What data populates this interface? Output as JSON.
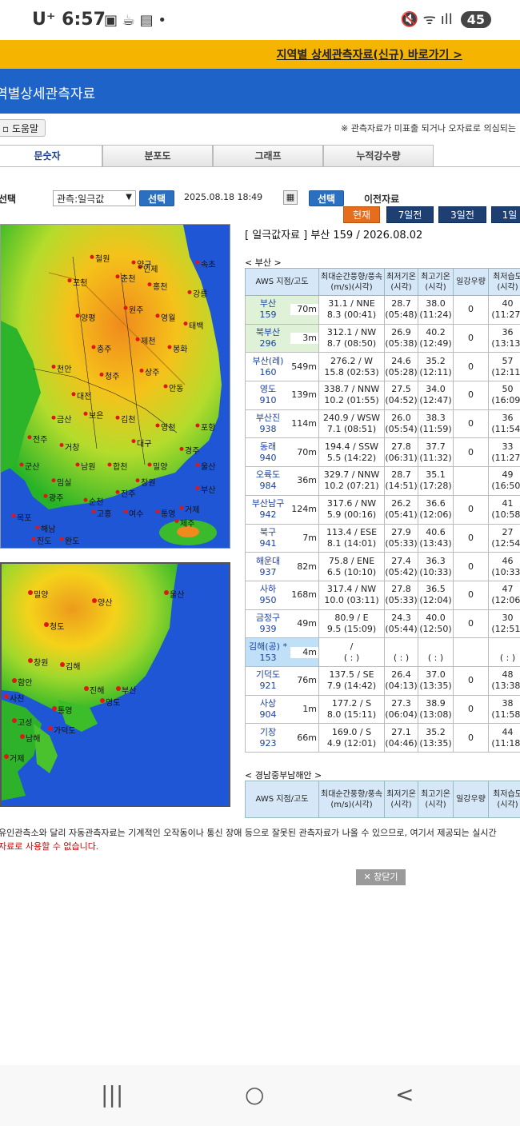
{
  "status": {
    "carrier": "U⁺",
    "time": "6:57",
    "left_icons": "▣ ☕ ▤ •",
    "right_icons": "🔇 ᯤ ıll",
    "battery": "45"
  },
  "banner": {
    "link": "지역별 상세관측자료(신규) 바로가기 >"
  },
  "header": {
    "title": "역별상세관측자료"
  },
  "help_button": "도움말",
  "notice": "※ 관측자료가 미표출 되거나 오자료로 의심되는",
  "tabs": [
    "문숫자",
    "분포도",
    "그래프",
    "누적강수량"
  ],
  "controls": {
    "label": "선택",
    "select_value": "관측:일극값",
    "select_button": "선택",
    "datetime": "2025.08.18 18:49",
    "select_button2": "선택",
    "prev_data": "이전자료"
  },
  "periods": [
    "현재",
    "7일전",
    "3일전",
    "1일"
  ],
  "panel_title": "[ 일극값자료 ] 부산 159 / 2026.08.02",
  "region1": "< 부산 >",
  "region2": "< 경남중부남해안 >",
  "table_headers": [
    "AWS 지점/고도",
    "최대순간풍향/풍속(m/s)(시각)",
    "최저기온(시각)",
    "최고기온(시각)",
    "일강우량",
    "최저습도(시각)"
  ],
  "table_headers2": [
    "AWS 지점/고도",
    "최대순간풍향/풍속(m/s)(시각)",
    "최저기온(시각)",
    "최고기온(시각)",
    "일강우량",
    "최저습도(시각)"
  ],
  "rows": [
    {
      "name": "부산",
      "id": "159",
      "alt": "70m",
      "wind1": "31.1 / NNE",
      "wind2": "8.3 (00:41)",
      "tmin": "28.7",
      "tmin_t": "(05:48)",
      "tmax": "38.0",
      "tmax_t": "(11:24)",
      "rain": "0",
      "hum": "40",
      "hum_t": "(11:27)",
      "hl": "green"
    },
    {
      "name": "북부산",
      "id": "296",
      "alt": "3m",
      "wind1": "312.1 / NW",
      "wind2": "8.7 (08:50)",
      "tmin": "26.9",
      "tmin_t": "(05:38)",
      "tmax": "40.2",
      "tmax_t": "(12:49)",
      "rain": "0",
      "hum": "36",
      "hum_t": "(13:13)",
      "hl": "green"
    },
    {
      "name": "부산(레)",
      "id": "160",
      "alt": "549m",
      "wind1": "276.2 / W",
      "wind2": "15.8 (02:53)",
      "tmin": "24.6",
      "tmin_t": "(05:28)",
      "tmax": "35.2",
      "tmax_t": "(12:11)",
      "rain": "0",
      "hum": "57",
      "hum_t": "(12:11)",
      "hl": ""
    },
    {
      "name": "영도",
      "id": "910",
      "alt": "139m",
      "wind1": "338.7 / NNW",
      "wind2": "10.2 (01:55)",
      "tmin": "27.5",
      "tmin_t": "(04:52)",
      "tmax": "34.0",
      "tmax_t": "(12:47)",
      "rain": "0",
      "hum": "50",
      "hum_t": "(16:09)",
      "hl": ""
    },
    {
      "name": "부산진",
      "id": "938",
      "alt": "114m",
      "wind1": "240.9 / WSW",
      "wind2": "7.1 (08:51)",
      "tmin": "26.0",
      "tmin_t": "(05:54)",
      "tmax": "38.3",
      "tmax_t": "(11:59)",
      "rain": "0",
      "hum": "36",
      "hum_t": "(11:54)",
      "hl": ""
    },
    {
      "name": "동래",
      "id": "940",
      "alt": "70m",
      "wind1": "194.4 / SSW",
      "wind2": "5.5 (14:22)",
      "tmin": "27.8",
      "tmin_t": "(06:31)",
      "tmax": "37.7",
      "tmax_t": "(11:32)",
      "rain": "0",
      "hum": "33",
      "hum_t": "(11:27)",
      "hl": ""
    },
    {
      "name": "오륙도",
      "id": "984",
      "alt": "36m",
      "wind1": "329.7 / NNW",
      "wind2": "10.2 (07:21)",
      "tmin": "28.7",
      "tmin_t": "(14:51)",
      "tmax": "35.1",
      "tmax_t": "(17:28)",
      "rain": "",
      "hum": "49",
      "hum_t": "(16:50)",
      "hl": ""
    },
    {
      "name": "부산남구",
      "id": "942",
      "alt": "124m",
      "wind1": "317.6 / NW",
      "wind2": "5.9 (00:16)",
      "tmin": "26.2",
      "tmin_t": "(05:41)",
      "tmax": "36.6",
      "tmax_t": "(12:06)",
      "rain": "0",
      "hum": "41",
      "hum_t": "(10:58)",
      "hl": ""
    },
    {
      "name": "북구",
      "id": "941",
      "alt": "7m",
      "wind1": "113.4 / ESE",
      "wind2": "8.1 (14:01)",
      "tmin": "27.9",
      "tmin_t": "(05:33)",
      "tmax": "40.6",
      "tmax_t": "(13:43)",
      "rain": "0",
      "hum": "27",
      "hum_t": "(12:54)",
      "hl": ""
    },
    {
      "name": "해운대",
      "id": "937",
      "alt": "82m",
      "wind1": "75.8 / ENE",
      "wind2": "6.5 (10:10)",
      "tmin": "27.4",
      "tmin_t": "(05:42)",
      "tmax": "36.3",
      "tmax_t": "(10:33)",
      "rain": "0",
      "hum": "46",
      "hum_t": "(10:33)",
      "hl": ""
    },
    {
      "name": "사하",
      "id": "950",
      "alt": "168m",
      "wind1": "317.4 / NW",
      "wind2": "10.0 (03:11)",
      "tmin": "27.8",
      "tmin_t": "(05:33)",
      "tmax": "36.5",
      "tmax_t": "(12:04)",
      "rain": "0",
      "hum": "47",
      "hum_t": "(12:06)",
      "hl": ""
    },
    {
      "name": "금정구",
      "id": "939",
      "alt": "49m",
      "wind1": "80.9 / E",
      "wind2": "9.5 (15:09)",
      "tmin": "24.3",
      "tmin_t": "(05:44)",
      "tmax": "40.0",
      "tmax_t": "(12:50)",
      "rain": "0",
      "hum": "30",
      "hum_t": "(12:51)",
      "hl": ""
    },
    {
      "name": "김해(공) *",
      "id": "153",
      "alt": "4m",
      "wind1": "/",
      "wind2": "( : )",
      "tmin": "",
      "tmin_t": "( : )",
      "tmax": "",
      "tmax_t": "( : )",
      "rain": "",
      "hum": "",
      "hum_t": "( : )",
      "hl": "blue"
    },
    {
      "name": "기덕도",
      "id": "921",
      "alt": "76m",
      "wind1": "137.5 / SE",
      "wind2": "7.9 (14:42)",
      "tmin": "26.4",
      "tmin_t": "(04:13)",
      "tmax": "37.0",
      "tmax_t": "(13:35)",
      "rain": "0",
      "hum": "48",
      "hum_t": "(13:38)",
      "hl": ""
    },
    {
      "name": "사상",
      "id": "904",
      "alt": "1m",
      "wind1": "177.2 / S",
      "wind2": "8.0 (15:11)",
      "tmin": "27.3",
      "tmin_t": "(06:04)",
      "tmax": "38.9",
      "tmax_t": "(13:08)",
      "rain": "0",
      "hum": "38",
      "hum_t": "(11:58)",
      "hl": ""
    },
    {
      "name": "기장",
      "id": "923",
      "alt": "66m",
      "wind1": "169.0 / S",
      "wind2": "4.9 (12:01)",
      "tmin": "27.1",
      "tmin_t": "(04:46)",
      "tmax": "35.2",
      "tmax_t": "(13:35)",
      "rain": "0",
      "hum": "44",
      "hum_t": "(11:18)",
      "hl": ""
    }
  ],
  "map1_labels": [
    "철원",
    "양구",
    "인제",
    "속초",
    "포천",
    "춘천",
    "홍천",
    "강릉",
    "양평",
    "원주",
    "영월",
    "태백",
    "충주",
    "제천",
    "봉화",
    "천안",
    "청주",
    "상주",
    "안동",
    "대전",
    "금산",
    "보은",
    "김천",
    "영천",
    "포항",
    "전주",
    "거창",
    "대구",
    "경주",
    "군산",
    "임실",
    "남원",
    "합천",
    "밀양",
    "울산",
    "광주",
    "순천",
    "진주",
    "창원",
    "부산",
    "목포",
    "해남",
    "고흥",
    "여수",
    "통영",
    "진도",
    "완도",
    "거제",
    "제주"
  ],
  "map2_labels": [
    "밀양",
    "양산",
    "울산",
    "청도",
    "김해",
    "창원",
    "함안",
    "부산",
    "진해",
    "통영",
    "거제",
    "고성",
    "남해",
    "사천",
    "영도",
    "가덕도"
  ],
  "footnote1": "유인관측소와 달리 자동관측자료는 기계적인 오작동이나 통신 장애 등으로 잘못된 관측자료가 나올 수 있으므로, 여기서 제공되는 실시간",
  "footnote2": "자료로 사용할 수 없습니다.",
  "close_button": "✕ 창닫기",
  "nav": {
    "recent": "|||",
    "home": "○",
    "back": "<"
  }
}
